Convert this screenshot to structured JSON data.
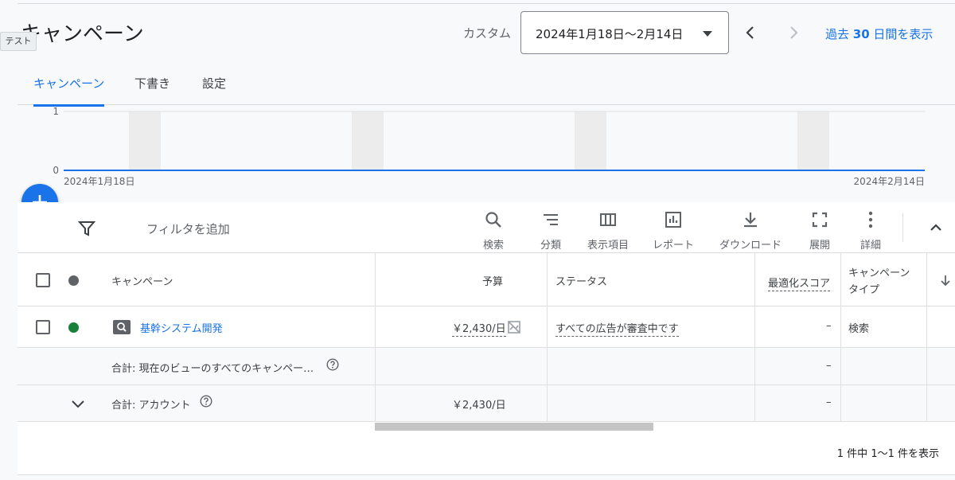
{
  "header": {
    "title": "キャンペーン",
    "env_badge": "テスト",
    "date_label": "カスタム",
    "date_range": "2024年1月18日〜2月14日",
    "past_link_prefix": "過去 ",
    "past_link_num": "30",
    "past_link_suffix": " 日間を表示"
  },
  "tabs": [
    {
      "label": "キャンペーン",
      "active": true
    },
    {
      "label": "下書き",
      "active": false
    },
    {
      "label": "設定",
      "active": false
    }
  ],
  "chart_data": {
    "type": "line",
    "x": [
      "2024年1月18日",
      "2024年2月14日"
    ],
    "series": [
      {
        "values": [
          0,
          0
        ]
      }
    ],
    "ylim": [
      0,
      1
    ],
    "yticks": [
      "1",
      "0"
    ],
    "x_start_label": "2024年1月18日",
    "x_end_label": "2024年2月14日",
    "grid": true,
    "line_color": "#1a73e8"
  },
  "toolbar": {
    "filter_add": "フィルタを追加",
    "tools": [
      {
        "icon": "search-icon",
        "label": "検索"
      },
      {
        "icon": "segment-icon",
        "label": "分類"
      },
      {
        "icon": "columns-icon",
        "label": "表示項目"
      },
      {
        "icon": "report-icon",
        "label": "レポート"
      },
      {
        "icon": "download-icon",
        "label": "ダウンロード"
      },
      {
        "icon": "fullscreen-icon",
        "label": "展開"
      },
      {
        "icon": "more-vert-icon",
        "label": "詳細"
      }
    ]
  },
  "table": {
    "headers": {
      "campaign": "キャンペーン",
      "budget": "予算",
      "status": "ステータス",
      "opt_score": "最適化スコア",
      "campaign_type_1": "キャンペーン",
      "campaign_type_2": "タイプ"
    },
    "rows": [
      {
        "name": "基幹システム開発",
        "budget": "￥2,430/日",
        "status": "すべての広告が審査中です",
        "opt_score": "–",
        "type": "検索",
        "status_color": "#188038"
      }
    ],
    "total_view": {
      "label": "合計: 現在のビューのすべてのキャンペー…",
      "opt_score": "–"
    },
    "total_account": {
      "label": "合計: アカウント",
      "budget": "￥2,430/日",
      "opt_score": "–"
    }
  },
  "footer": {
    "count": "1 件中 1〜1 件を表示"
  },
  "colors": {
    "accent": "#1a73e8",
    "status_enabled": "#188038",
    "header_dot": "#5f6368"
  }
}
